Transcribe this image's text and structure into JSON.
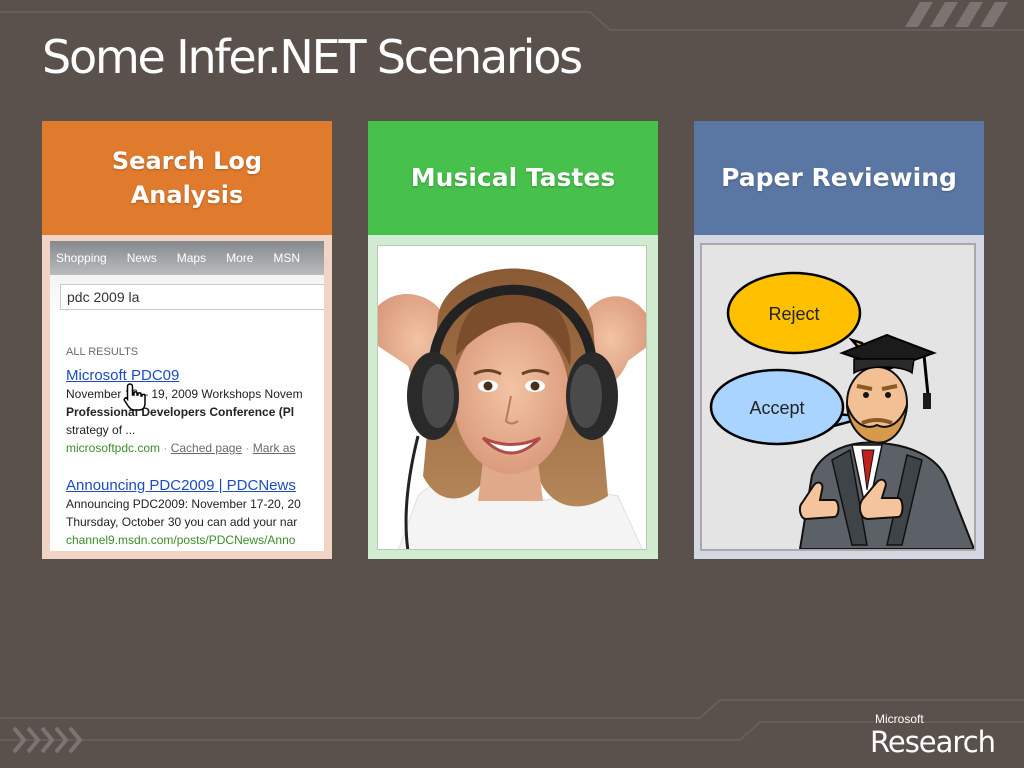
{
  "slide": {
    "title": "Some Infer.NET Scenarios"
  },
  "cards": [
    {
      "title": "Search Log Analysis",
      "title_lines": [
        "Search Log",
        "Analysis"
      ],
      "color": "#e07b2e",
      "search_screenshot": {
        "nav_items": [
          "Shopping",
          "News",
          "Maps",
          "More",
          "MSN"
        ],
        "query": "pdc 2009 la",
        "results_label": "ALL RESULTS",
        "results": [
          {
            "title": "Microsoft PDC09",
            "lines": [
              "November 16 – 19, 2009 Workshops Novem",
              "Professional Developers Conference (Pl",
              "strategy of ..."
            ],
            "url": "microsoftpdc.com",
            "links": [
              "Cached page",
              "Mark as"
            ]
          },
          {
            "title": "Announcing PDC2009 | PDCNews",
            "lines": [
              "Announcing PDC2009: November 17-20, 20",
              "Thursday, October 30 you can add your nar"
            ],
            "url": "channel9.msdn.com/posts/PDCNews/Anno"
          }
        ]
      }
    },
    {
      "title": "Musical Tastes",
      "color": "#48c04c"
    },
    {
      "title": "Paper Reviewing",
      "color": "#5a77a4",
      "bubbles": {
        "reject": "Reject",
        "accept": "Accept"
      }
    }
  ],
  "footer": {
    "brand_top": "Microsoft",
    "brand_main": "Research"
  },
  "colors": {
    "background": "#5a514d",
    "bubble_reject": "#ffc000",
    "bubble_accept": "#a9d4ff"
  }
}
